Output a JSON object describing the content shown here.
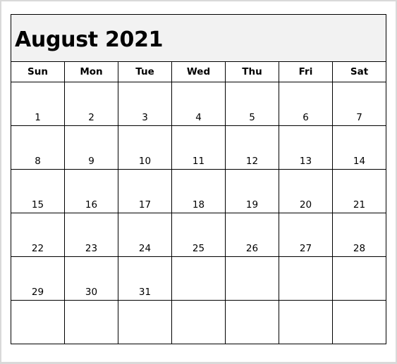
{
  "calendar": {
    "title": "August 2021",
    "month": "August",
    "year": 2021,
    "weekdays": [
      "Sun",
      "Mon",
      "Tue",
      "Wed",
      "Thu",
      "Fri",
      "Sat"
    ],
    "weeks": [
      [
        "1",
        "2",
        "3",
        "4",
        "5",
        "6",
        "7"
      ],
      [
        "8",
        "9",
        "10",
        "11",
        "12",
        "13",
        "14"
      ],
      [
        "15",
        "16",
        "17",
        "18",
        "19",
        "20",
        "21"
      ],
      [
        "22",
        "23",
        "24",
        "25",
        "26",
        "27",
        "28"
      ],
      [
        "29",
        "30",
        "31",
        "",
        "",
        "",
        ""
      ],
      [
        "",
        "",
        "",
        "",
        "",
        "",
        ""
      ]
    ]
  },
  "colors": {
    "title_background": "#f2f2f2",
    "grid_lines": "#000000",
    "page_border": "#d9d9d9"
  }
}
